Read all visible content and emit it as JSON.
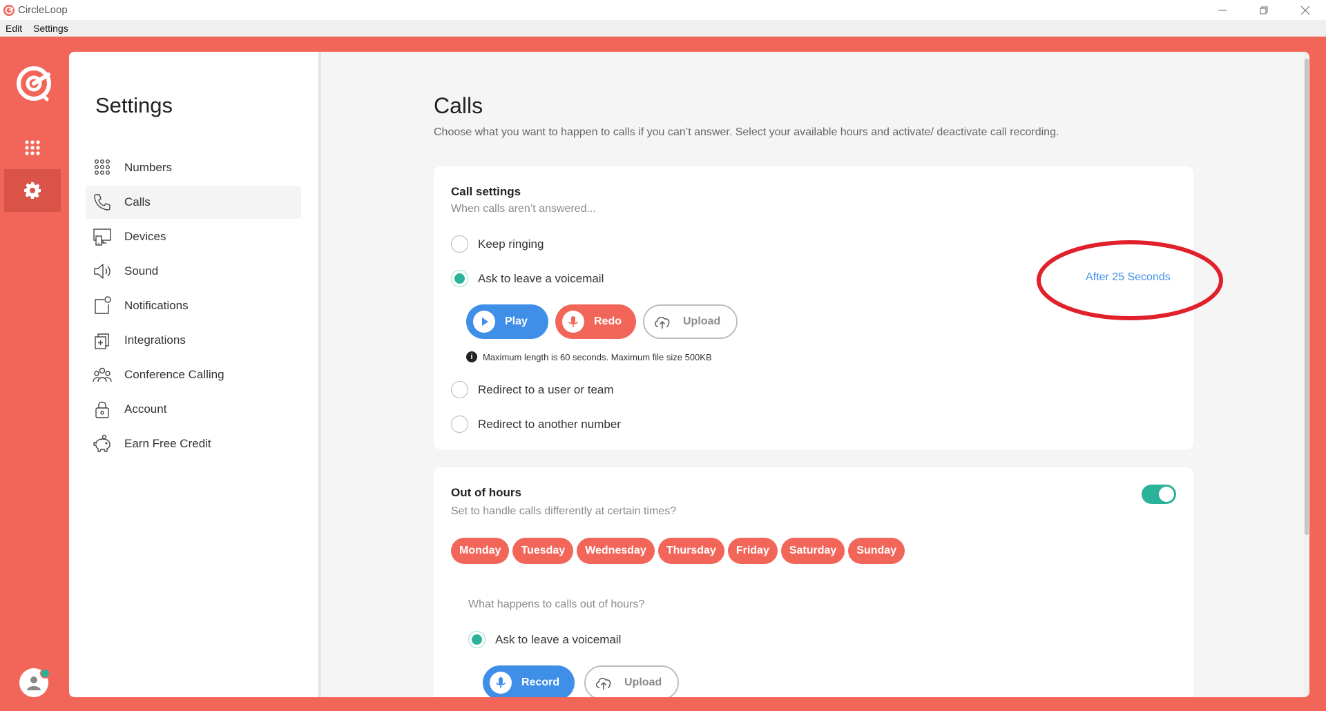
{
  "window": {
    "title": "CircleLoop",
    "controls": [
      "minimize",
      "restore",
      "close"
    ]
  },
  "menubar": {
    "items": [
      "Edit",
      "Settings"
    ]
  },
  "rail": {
    "items": [
      {
        "name": "dialpad",
        "icon": "dialpad-icon"
      },
      {
        "name": "settings",
        "icon": "gear-icon",
        "active": true
      }
    ]
  },
  "sidebar": {
    "title": "Settings",
    "items": [
      {
        "label": "Numbers",
        "icon": "numbers-grid-icon"
      },
      {
        "label": "Calls",
        "icon": "phone-icon",
        "active": true
      },
      {
        "label": "Devices",
        "icon": "devices-icon"
      },
      {
        "label": "Sound",
        "icon": "speaker-icon"
      },
      {
        "label": "Notifications",
        "icon": "notification-icon"
      },
      {
        "label": "Integrations",
        "icon": "integrations-icon"
      },
      {
        "label": "Conference Calling",
        "icon": "conference-icon"
      },
      {
        "label": "Account",
        "icon": "lock-icon"
      },
      {
        "label": "Earn Free Credit",
        "icon": "piggy-bank-icon"
      }
    ]
  },
  "main": {
    "title": "Calls",
    "description": "Choose what you want to happen to calls if you can’t answer. Select your available hours and activate/ deactivate call recording."
  },
  "call_settings": {
    "title": "Call settings",
    "subtitle": "When calls aren’t answered...",
    "options": [
      {
        "label": "Keep ringing",
        "checked": false
      },
      {
        "label": "Ask to leave a voicemail",
        "checked": true
      },
      {
        "label": "Redirect to a user or team",
        "checked": false
      },
      {
        "label": "Redirect to another number",
        "checked": false
      }
    ],
    "after_link": "After 25 Seconds",
    "buttons": {
      "play": "Play",
      "redo": "Redo",
      "upload": "Upload"
    },
    "note": "Maximum length is 60 seconds. Maximum file size 500KB"
  },
  "out_of_hours": {
    "title": "Out of hours",
    "subtitle": "Set to handle calls differently at certain times?",
    "enabled": true,
    "days": [
      "Monday",
      "Tuesday",
      "Wednesday",
      "Thursday",
      "Friday",
      "Saturday",
      "Sunday"
    ],
    "question": "What happens to calls out of hours?",
    "option": {
      "label": "Ask to leave a voicemail",
      "checked": true
    },
    "buttons": {
      "record": "Record",
      "upload": "Upload"
    }
  },
  "colors": {
    "brand_orange": "#f2665a",
    "accent_blue": "#3f8ee8",
    "accent_teal": "#2bb39a",
    "annotation_red": "#e0202a"
  }
}
